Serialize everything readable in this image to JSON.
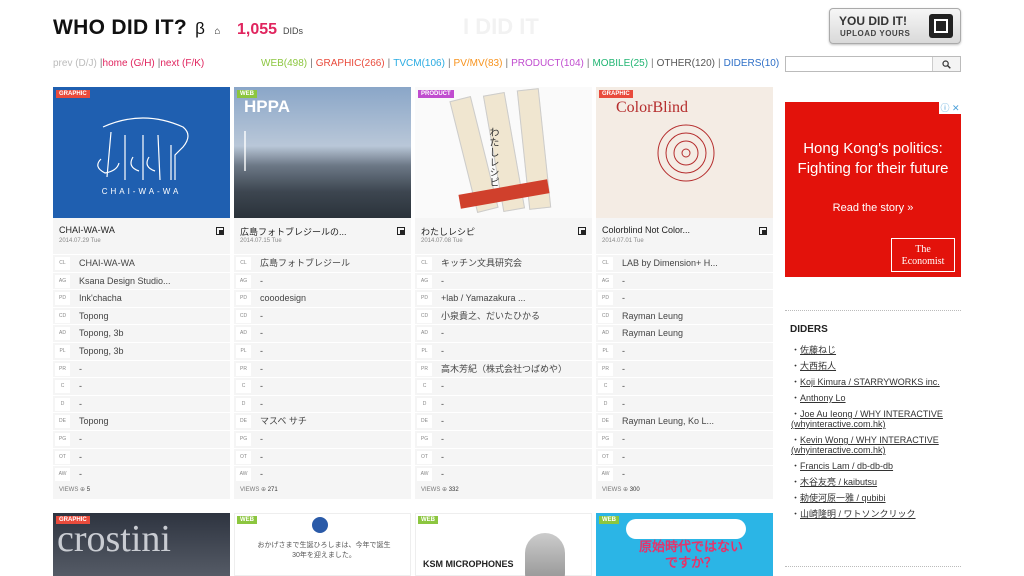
{
  "header": {
    "title": "WHO DID IT?",
    "beta": "β",
    "home_glyph": "⌂",
    "count": "1,055",
    "count_label": "DIDs",
    "ghost_text": "I DID IT",
    "upload_line1": "YOU DID IT!",
    "upload_line2": "UPLOAD YOURS"
  },
  "nav": {
    "prev": "prev (D/J)",
    "home": "home (G/H)",
    "next": "next (F/K)",
    "sep": "|"
  },
  "categories": [
    {
      "label": "WEB(498)",
      "color": "#8cc63f"
    },
    {
      "label": "GRAPHIC(266)",
      "color": "#e94b3c"
    },
    {
      "label": "TVCM(106)",
      "color": "#29abe2"
    },
    {
      "label": "PV/MV(83)",
      "color": "#f7931e"
    },
    {
      "label": "PRODUCT(104)",
      "color": "#c04ccf"
    },
    {
      "label": "MOBILE(25)",
      "color": "#22b573"
    },
    {
      "label": "OTHER(120)",
      "color": "#555555"
    },
    {
      "label": "DIDERS(10)",
      "color": "#2e6fc7"
    }
  ],
  "cards": [
    {
      "badge": "GRAPHIC",
      "badge_color": "#e94b3c",
      "title": "CHAI-WA-WA",
      "date": "2014.07.29 Tue",
      "views": "5",
      "img_text": "CHAI-WA-WA",
      "rows": [
        {
          "k": "CL",
          "v": "CHAI-WA-WA"
        },
        {
          "k": "AG",
          "v": "Ksana Design Studio..."
        },
        {
          "k": "PD",
          "v": "Ink'chacha"
        },
        {
          "k": "CD",
          "v": "Topong"
        },
        {
          "k": "AD",
          "v": "Topong, 3b"
        },
        {
          "k": "PL",
          "v": "Topong, 3b"
        },
        {
          "k": "PR",
          "v": "-"
        },
        {
          "k": "C",
          "v": "-"
        },
        {
          "k": "D",
          "v": "-"
        },
        {
          "k": "DE",
          "v": "Topong"
        },
        {
          "k": "PG",
          "v": "-"
        },
        {
          "k": "OT",
          "v": "-"
        },
        {
          "k": "AW",
          "v": "-"
        }
      ]
    },
    {
      "badge": "WEB",
      "badge_color": "#8cc63f",
      "title": "広島フォトブレジールの...",
      "date": "2014.07.15 Tue",
      "views": "271",
      "img_text": "HPPA",
      "rows": [
        {
          "k": "CL",
          "v": "広島フォトブレジール"
        },
        {
          "k": "AG",
          "v": "-"
        },
        {
          "k": "PD",
          "v": "cooodesign"
        },
        {
          "k": "CD",
          "v": "-"
        },
        {
          "k": "AD",
          "v": "-"
        },
        {
          "k": "PL",
          "v": "-"
        },
        {
          "k": "PR",
          "v": "-"
        },
        {
          "k": "C",
          "v": "-"
        },
        {
          "k": "D",
          "v": "-"
        },
        {
          "k": "DE",
          "v": "マスベ サチ"
        },
        {
          "k": "PG",
          "v": "-"
        },
        {
          "k": "OT",
          "v": "-"
        },
        {
          "k": "AW",
          "v": "-"
        }
      ]
    },
    {
      "badge": "PRODUCT",
      "badge_color": "#c04ccf",
      "title": "わたしレシピ",
      "date": "2014.07.08 Tue",
      "views": "332",
      "img_text": "わたしレシピ",
      "rows": [
        {
          "k": "CL",
          "v": "キッチン文具研究会"
        },
        {
          "k": "AG",
          "v": "-"
        },
        {
          "k": "PD",
          "v": "+lab / Yamazakura ..."
        },
        {
          "k": "CD",
          "v": "小泉貴之、だいたひかる"
        },
        {
          "k": "AD",
          "v": "-"
        },
        {
          "k": "PL",
          "v": "-"
        },
        {
          "k": "PR",
          "v": "高木芳紀（株式会社つばめや）"
        },
        {
          "k": "C",
          "v": "-"
        },
        {
          "k": "D",
          "v": "-"
        },
        {
          "k": "DE",
          "v": "-"
        },
        {
          "k": "PG",
          "v": "-"
        },
        {
          "k": "OT",
          "v": "-"
        },
        {
          "k": "AW",
          "v": "-"
        }
      ]
    },
    {
      "badge": "GRAPHIC",
      "badge_color": "#e94b3c",
      "title": "Colorblind Not Color...",
      "date": "2014.07.01 Tue",
      "views": "300",
      "img_text": "ColorBlind",
      "rows": [
        {
          "k": "CL",
          "v": "LAB by Dimension+ H..."
        },
        {
          "k": "AG",
          "v": "-"
        },
        {
          "k": "PD",
          "v": "-"
        },
        {
          "k": "CD",
          "v": "Rayman Leung"
        },
        {
          "k": "AD",
          "v": "Rayman Leung"
        },
        {
          "k": "PL",
          "v": "-"
        },
        {
          "k": "PR",
          "v": "-"
        },
        {
          "k": "C",
          "v": "-"
        },
        {
          "k": "D",
          "v": "-"
        },
        {
          "k": "DE",
          "v": "Rayman Leung, Ko L..."
        },
        {
          "k": "PG",
          "v": "-"
        },
        {
          "k": "OT",
          "v": "-"
        },
        {
          "k": "AW",
          "v": "-"
        }
      ]
    }
  ],
  "views_label": "VIEWS",
  "bottom_cards": [
    {
      "badge": "GRAPHIC",
      "badge_color": "#e94b3c",
      "img_text": "crostini"
    },
    {
      "badge": "WEB",
      "badge_color": "#8cc63f",
      "img_text": "おかげさまで生誕ひろしまは、今年で誕生30年を迎えました。"
    },
    {
      "badge": "WEB",
      "badge_color": "#8cc63f",
      "img_text": "KSM MICROPHONES"
    },
    {
      "badge": "WEB",
      "badge_color": "#8cc63f",
      "img_text": "原始時代ではないですか？"
    }
  ],
  "ad": {
    "line1": "Hong Kong's politics:",
    "line2": "Fighting for their future",
    "cta": "Read the story »",
    "logo_l1": "The",
    "logo_l2": "Economist",
    "close": "ⓘ ✕"
  },
  "diders": {
    "title": "DIDERS",
    "items": [
      "佐藤ねじ",
      "大西拓人",
      "Koji Kimura / STARRYWORKS inc.",
      "Anthony Lo",
      "Joe Au Ieong / WHY INTERACTIVE (whyinteractive.com.hk)",
      "Kevin Wong / WHY INTERACTIVE (whyinteractive.com.hk)",
      "Francis Lam / db-db-db",
      "木谷友亮 / kaibutsu",
      "勅使河原一雅 / qubibi",
      "山崎隆明 / ワトソンクリック"
    ]
  }
}
